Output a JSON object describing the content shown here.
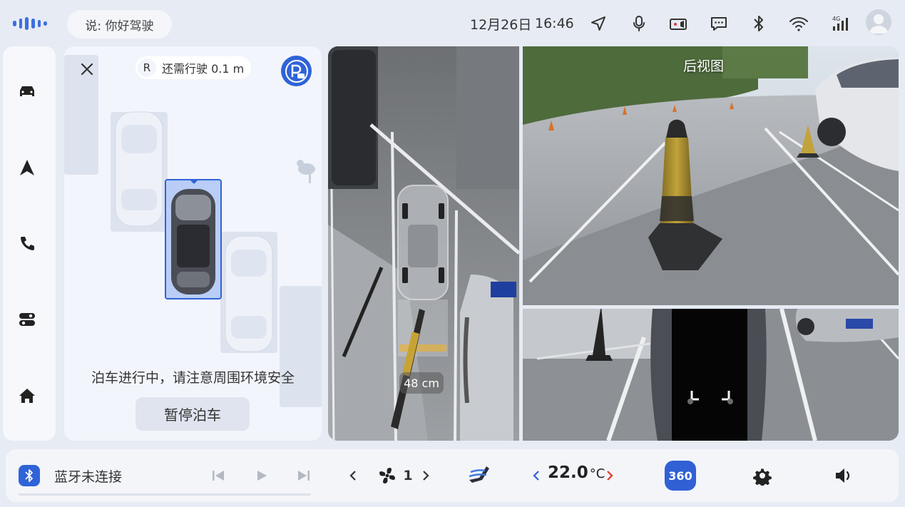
{
  "status_bar": {
    "voice_prompt": "说: 你好驾驶",
    "date": "12月26日",
    "time": "16:46",
    "icons": [
      "navigation-arrow-icon",
      "microphone-icon",
      "dashcam-icon",
      "message-icon",
      "bluetooth-icon",
      "wifi-icon",
      "cellular-4g-icon"
    ]
  },
  "sidebar": {
    "items": [
      {
        "icon": "car-icon"
      },
      {
        "icon": "navigation-icon"
      },
      {
        "icon": "phone-icon"
      },
      {
        "icon": "toggles-icon"
      },
      {
        "icon": "home-icon"
      }
    ]
  },
  "parking": {
    "gear": "R",
    "remaining_label": "还需行驶 0.1 m",
    "status_message": "泊车进行中，请注意周围环境安全",
    "pause_button": "暂停泊车"
  },
  "cameras": {
    "obstacle_distance": "48 cm",
    "rear_view_label": "后视图"
  },
  "bottom_bar": {
    "bluetooth_status": "蓝牙未连接",
    "fan_level": "1",
    "temperature": "22.0",
    "temperature_unit": "°C",
    "view_360_label": "360"
  },
  "colors": {
    "accent": "#2f63d8",
    "background": "#e6ebf4",
    "panel": "#f2f5fb"
  }
}
